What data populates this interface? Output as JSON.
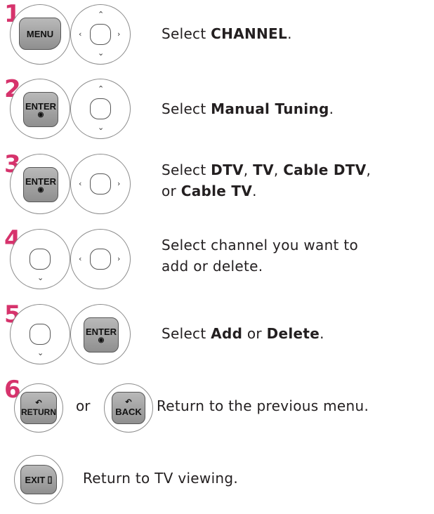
{
  "steps": [
    {
      "number": "1",
      "buttons": {
        "a": "MENU"
      },
      "text": {
        "pre": "Select ",
        "bold1": "CHANNEL",
        "post": "."
      }
    },
    {
      "number": "2",
      "buttons": {
        "a": "ENTER"
      },
      "text": {
        "pre": "Select ",
        "bold1": "Manual Tuning",
        "post": "."
      }
    },
    {
      "number": "3",
      "buttons": {
        "a": "ENTER"
      },
      "text": {
        "pre": "Select ",
        "b1": "DTV",
        "s1": ", ",
        "b2": "TV",
        "s2": ", ",
        "b3": "Cable DTV",
        "s3": ",",
        "line2_pre": "or ",
        "b4": "Cable TV",
        "post": "."
      }
    },
    {
      "number": "4",
      "text": {
        "line1": "Select channel you want to",
        "line2": "add or delete."
      }
    },
    {
      "number": "5",
      "buttons": {
        "b": "ENTER"
      },
      "text": {
        "pre": "Select ",
        "b1": "Add",
        "mid": " or ",
        "b2": "Delete",
        "post": "."
      }
    },
    {
      "number": "6",
      "buttons": {
        "a": "RETURN",
        "b": "BACK"
      },
      "or": "or",
      "text": "Return to the previous menu."
    }
  ],
  "exit": {
    "button": "EXIT",
    "text": "Return to TV viewing."
  },
  "colors": {
    "step_number": "#d6336c",
    "button_fill": "#a3a3a3"
  }
}
